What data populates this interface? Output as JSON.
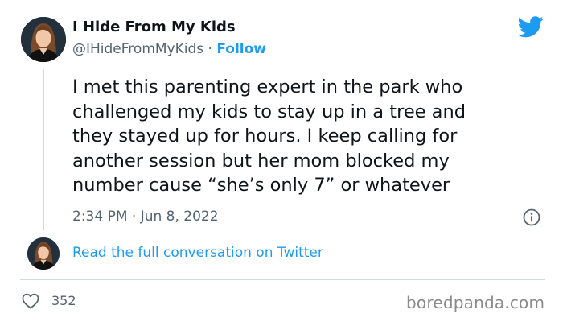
{
  "author": {
    "display_name": "I Hide From My Kids",
    "handle": "@IHideFromMyKids",
    "separator": "·",
    "follow_label": "Follow"
  },
  "tweet": {
    "lines": [
      "I met this parenting expert in the park who",
      "challenged my kids to stay up in a tree and",
      "they stayed up for hours. I keep calling for",
      "another session but her mom blocked my",
      "number cause “she’s only 7” or whatever"
    ],
    "timestamp": "2:34 PM · Jun 8, 2022"
  },
  "conversation": {
    "link_label": "Read the full conversation on Twitter"
  },
  "engagement": {
    "likes": "352"
  },
  "watermark": "boredpanda.com",
  "colors": {
    "accent": "#1d9bf0",
    "text": "#0f1419",
    "muted": "#536471",
    "divider": "#cfd9de"
  },
  "icons": {
    "brand": "twitter-bird-icon",
    "info": "info-icon",
    "like": "heart-icon"
  }
}
